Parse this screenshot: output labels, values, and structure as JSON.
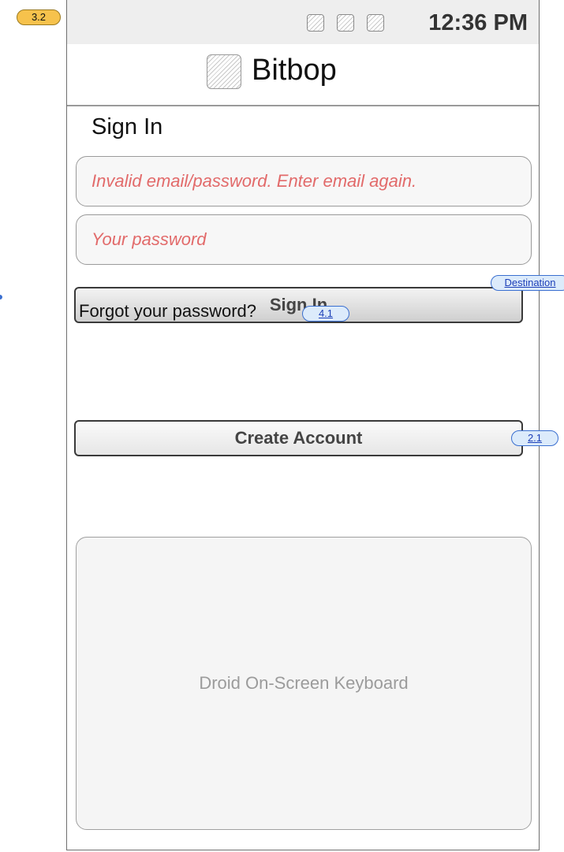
{
  "status_bar": {
    "time": "12:36 PM",
    "icons": [
      "signal-icon",
      "wifi-icon",
      "battery-icon"
    ]
  },
  "header": {
    "app_name": "Bitbop",
    "logo_icon": "app-logo-icon"
  },
  "screen": {
    "heading": "Sign In"
  },
  "form": {
    "email_value": "Invalid email/password. Enter email again.",
    "password_placeholder": "Your password",
    "sign_in_label": "Sign In",
    "forgot_label": "Forgot your password?",
    "create_account_label": "Create Account"
  },
  "keyboard": {
    "label": "Droid On-Screen Keyboard"
  },
  "annotations": {
    "screen_id": "3.2",
    "sign_in_link": "Destination",
    "forgot_link": "4.1",
    "create_link": "2.1"
  },
  "colors": {
    "error_text": "#e26a6a",
    "annotation_orange": "#f6c24c",
    "annotation_blue": "#dcebfb",
    "frame_border": "#6f6f6f"
  }
}
